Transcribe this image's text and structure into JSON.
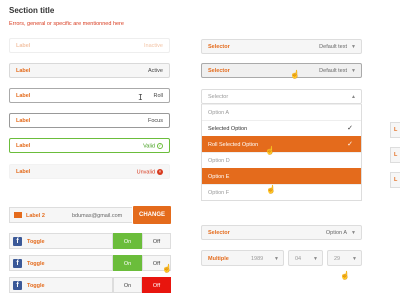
{
  "header": {
    "title": "Section title",
    "subtitle": "Errors, general or specific are mentionned here"
  },
  "fields": [
    {
      "label": "Label",
      "value": "Inactive",
      "state": "disabled"
    },
    {
      "label": "Label",
      "value": "Active",
      "state": "default"
    },
    {
      "label": "Label",
      "value": "Roll",
      "state": "hover"
    },
    {
      "label": "Label",
      "value": "Focus",
      "state": "focus"
    },
    {
      "label": "Label",
      "value": "Valid",
      "state": "valid"
    },
    {
      "label": "Label",
      "value": "Unvalid",
      "state": "invalid"
    }
  ],
  "email": {
    "label": "Label 2",
    "value": "bdumas@gmail.com",
    "button": "CHANGE"
  },
  "toggles": [
    {
      "label": "Toggle",
      "on": "On",
      "off": "Off",
      "selected": "on"
    },
    {
      "label": "Toggle",
      "on": "On",
      "off": "Off",
      "selected": "on"
    },
    {
      "label": "Toggle",
      "on": "On",
      "off": "Off",
      "selected": "off"
    }
  ],
  "selects": {
    "first": {
      "label": "Selector",
      "value": "Default text"
    },
    "second": {
      "label": "Selector",
      "value": "Default text"
    },
    "open": {
      "placeholder": "Selector"
    },
    "options": [
      {
        "text": "Option A",
        "state": "normal"
      },
      {
        "text": "Selected Option",
        "state": "selected"
      },
      {
        "text": "Roll Selected Option",
        "state": "highlight"
      },
      {
        "text": "Option D",
        "state": "normal"
      },
      {
        "text": "Option E",
        "state": "highlight"
      },
      {
        "text": "Option F",
        "state": "normal"
      }
    ],
    "third": {
      "label": "Selector",
      "value": "Option A"
    }
  },
  "multiple": {
    "label": "Multiple",
    "year": "1989",
    "month": "04",
    "day": "29"
  },
  "edge_buttons": [
    "L",
    "L",
    "L"
  ],
  "icons": {
    "check": "✓",
    "caret_down": "▼",
    "caret_up": "▲"
  }
}
